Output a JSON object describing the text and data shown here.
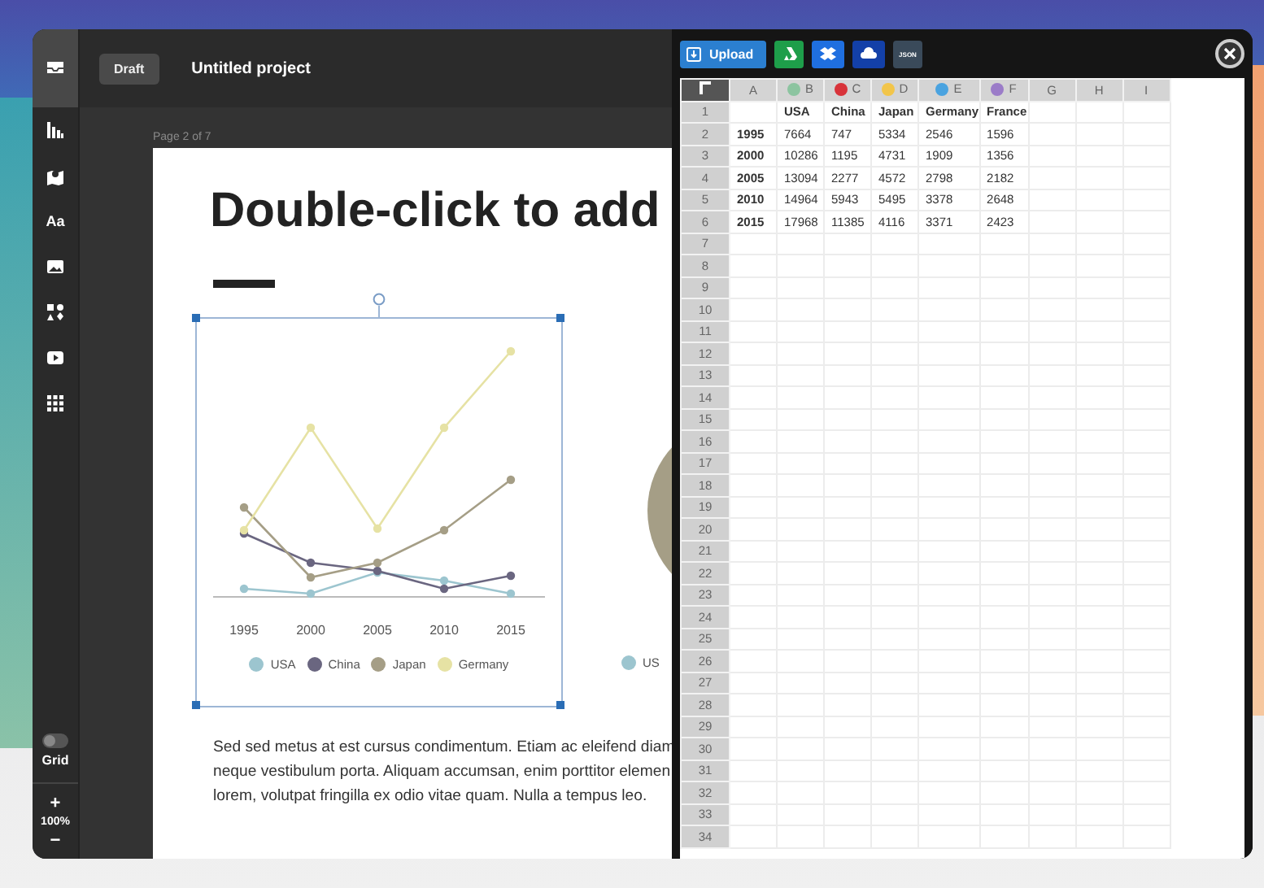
{
  "sidebar": {
    "tools": [
      {
        "kind": "inbox",
        "selected": true
      },
      {
        "kind": "chart",
        "selected": false
      },
      {
        "kind": "map",
        "selected": false
      },
      {
        "kind": "text",
        "label": "Aa",
        "selected": false
      },
      {
        "kind": "image",
        "selected": false
      },
      {
        "kind": "shapes",
        "selected": false
      },
      {
        "kind": "video",
        "selected": false
      },
      {
        "kind": "grid",
        "selected": false
      }
    ],
    "grid_toggle": {
      "label": "Grid",
      "on": false
    },
    "zoom": {
      "plus": "+",
      "value": "100%",
      "minus": "−"
    }
  },
  "header": {
    "status": "Draft",
    "title": "Untitled project"
  },
  "document": {
    "page_label": "Page 2 of 7",
    "title": "Double-click to add",
    "paragraph": "Sed sed metus at est cursus condimentum. Etiam ac eleifend diam\nneque vestibulum porta. Aliquam accumsan, enim porttitor elemen\nlorem, volutpat fringilla ex odio vitae quam. Nulla a tempus leo.",
    "line_chart": {
      "x_labels": [
        "1995",
        "2000",
        "2005",
        "2010",
        "2015"
      ],
      "legend": [
        {
          "label": "USA",
          "color": "#9cc5cf"
        },
        {
          "label": "China",
          "color": "#6a6680"
        },
        {
          "label": "Japan",
          "color": "#a59e86"
        },
        {
          "label": "Germany",
          "color": "#e6e2a4"
        }
      ]
    },
    "pie_chart": {
      "legend": [
        {
          "label": "US",
          "color": "#9cc5cf"
        }
      ]
    }
  },
  "sheet": {
    "toolbar": [
      {
        "kind": "upload",
        "label": "Upload"
      },
      {
        "kind": "drive"
      },
      {
        "kind": "dropbox"
      },
      {
        "kind": "cloud"
      },
      {
        "kind": "json",
        "label": "JSON"
      }
    ],
    "columns": [
      {
        "label": "A"
      },
      {
        "label": "B",
        "color": "#8cc4a0"
      },
      {
        "label": "C",
        "color": "#d8333a"
      },
      {
        "label": "D",
        "color": "#f2c54a"
      },
      {
        "label": "E",
        "color": "#4aa3e0"
      },
      {
        "label": "F",
        "color": "#9b7cc8"
      },
      {
        "label": "G"
      },
      {
        "label": "H"
      },
      {
        "label": "I"
      }
    ],
    "rows": [
      {
        "number": "1",
        "values": [
          "USA",
          "China",
          "Japan",
          "Germany",
          "France"
        ]
      },
      {
        "number": "2",
        "label": "1995",
        "values": [
          "7664",
          "747",
          "5334",
          "2546",
          "1596"
        ]
      },
      {
        "number": "3",
        "label": "2000",
        "values": [
          "10286",
          "1195",
          "4731",
          "1909",
          "1356"
        ]
      },
      {
        "number": "4",
        "label": "2005",
        "values": [
          "13094",
          "2277",
          "4572",
          "2798",
          "2182"
        ]
      },
      {
        "number": "5",
        "label": "2010",
        "values": [
          "14964",
          "5943",
          "5495",
          "3378",
          "2648"
        ]
      },
      {
        "number": "6",
        "label": "2015",
        "values": [
          "17968",
          "11385",
          "4116",
          "3371",
          "2423"
        ]
      },
      {
        "number": "7"
      },
      {
        "number": "8"
      },
      {
        "number": "9"
      },
      {
        "number": "10"
      },
      {
        "number": "11"
      },
      {
        "number": "12"
      },
      {
        "number": "13"
      },
      {
        "number": "14"
      },
      {
        "number": "15"
      },
      {
        "number": "16"
      },
      {
        "number": "17"
      },
      {
        "number": "18"
      },
      {
        "number": "19"
      },
      {
        "number": "20"
      },
      {
        "number": "21"
      },
      {
        "number": "22"
      },
      {
        "number": "23"
      },
      {
        "number": "24"
      },
      {
        "number": "25"
      },
      {
        "number": "26"
      },
      {
        "number": "27"
      },
      {
        "number": "28"
      },
      {
        "number": "29"
      },
      {
        "number": "30"
      },
      {
        "number": "31"
      },
      {
        "number": "32"
      },
      {
        "number": "33"
      },
      {
        "number": "34"
      }
    ]
  }
}
